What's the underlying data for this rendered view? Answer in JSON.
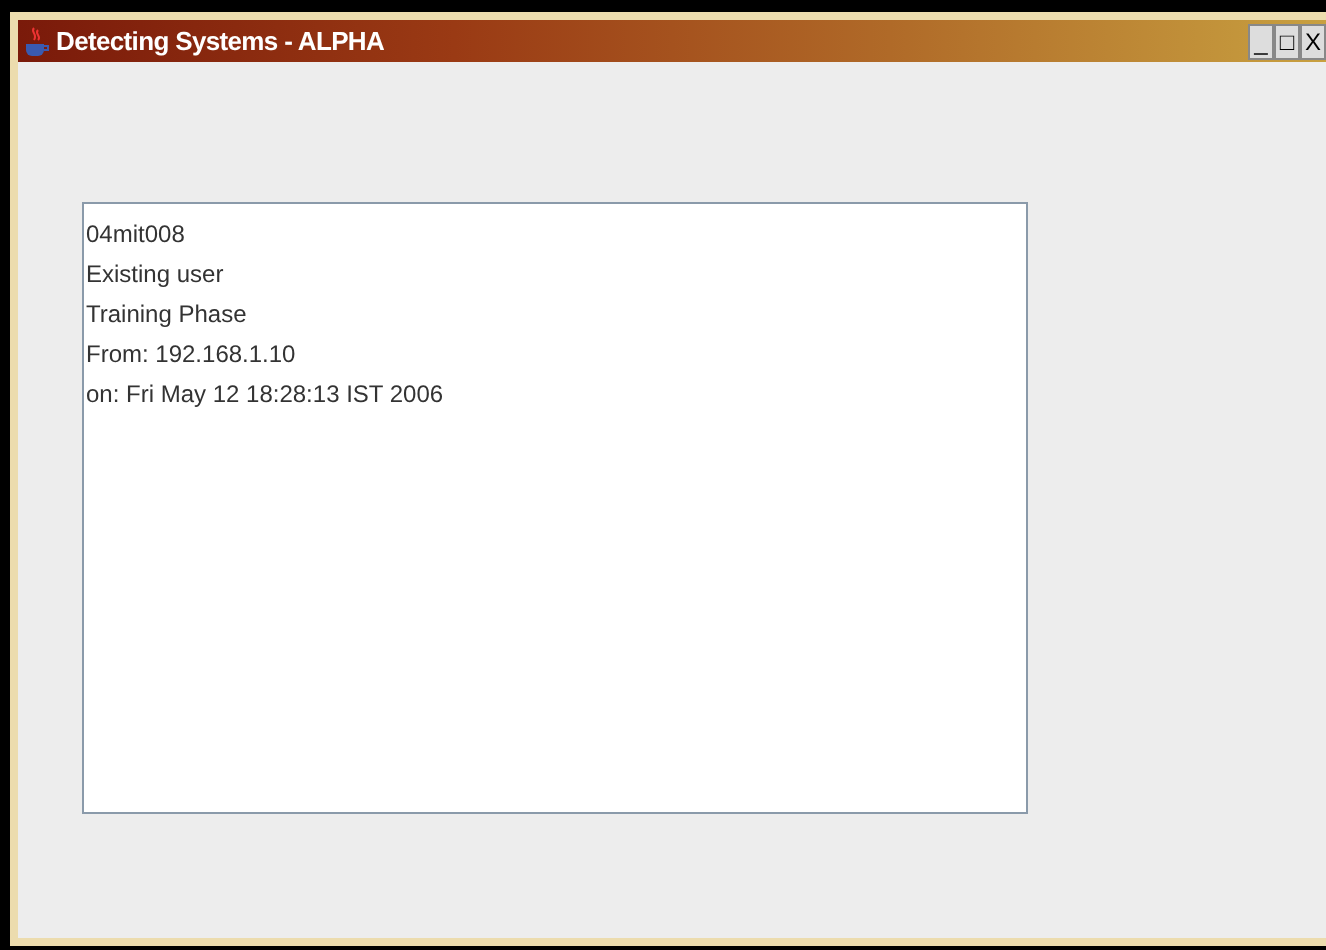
{
  "window": {
    "title": "Detecting Systems - ALPHA",
    "controls": [
      "_",
      "□",
      "X"
    ]
  },
  "text_area": {
    "lines": [
      "04mit008",
      "Existing user",
      "Training Phase",
      "From: 192.168.1.10",
      "on: Fri May 12 18:28:13 IST 2006"
    ]
  }
}
